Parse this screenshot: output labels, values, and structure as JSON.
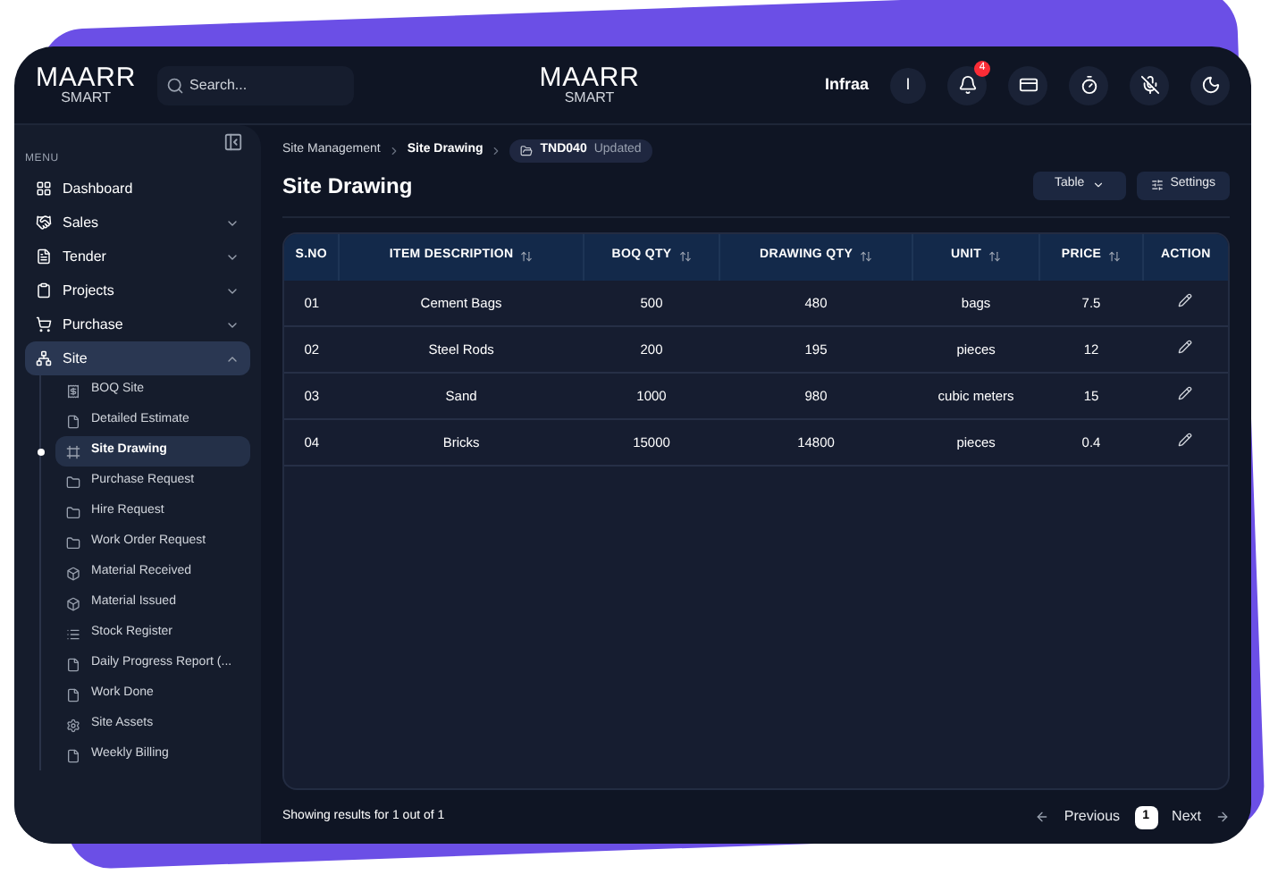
{
  "logo": {
    "name": "MAARR",
    "sub": "SMART"
  },
  "search": {
    "placeholder": "Search..."
  },
  "header": {
    "center_logo": {
      "name": "MAARR",
      "sub": "SMART"
    },
    "user": "Infraa",
    "avatar": "I",
    "notifications": "4"
  },
  "sidebar": {
    "menu_label": "MENU",
    "items": [
      {
        "label": "Dashboard",
        "expandable": false,
        "expanded": false,
        "selected": false
      },
      {
        "label": "Sales",
        "expandable": true,
        "expanded": false,
        "selected": false
      },
      {
        "label": "Tender",
        "expandable": true,
        "expanded": false,
        "selected": false
      },
      {
        "label": "Projects",
        "expandable": true,
        "expanded": false,
        "selected": false
      },
      {
        "label": "Purchase",
        "expandable": true,
        "expanded": false,
        "selected": false
      },
      {
        "label": "Site",
        "expandable": true,
        "expanded": true,
        "selected": true,
        "children": [
          {
            "label": "BOQ Site",
            "selected": false
          },
          {
            "label": "Detailed Estimate",
            "selected": false
          },
          {
            "label": "Site Drawing",
            "selected": true
          },
          {
            "label": "Purchase Request",
            "selected": false
          },
          {
            "label": "Hire Request",
            "selected": false
          },
          {
            "label": "Work Order Request",
            "selected": false
          },
          {
            "label": "Material Received",
            "selected": false
          },
          {
            "label": "Material Issued",
            "selected": false
          },
          {
            "label": "Stock Register",
            "selected": false
          },
          {
            "label": "Daily Progress Report (...",
            "selected": false
          },
          {
            "label": "Work Done",
            "selected": false
          },
          {
            "label": "Site Assets",
            "selected": false
          },
          {
            "label": "Weekly Billing",
            "selected": false
          }
        ]
      }
    ]
  },
  "breadcrumb": [
    "Site Management",
    "Site Drawing"
  ],
  "tag": {
    "code": "TND040",
    "status": "Updated"
  },
  "page_title": "Site Drawing",
  "toolbar": {
    "view": "Table",
    "settings": "Settings"
  },
  "table": {
    "columns": [
      {
        "label": "S.NO",
        "sortable": false
      },
      {
        "label": "ITEM DESCRIPTION",
        "sortable": true
      },
      {
        "label": "BOQ QTY",
        "sortable": true
      },
      {
        "label": "DRAWING QTY",
        "sortable": true
      },
      {
        "label": "UNIT",
        "sortable": true
      },
      {
        "label": "PRICE",
        "sortable": true
      },
      {
        "label": "ACTION",
        "sortable": false
      }
    ],
    "rows": [
      [
        "01",
        "Cement Bags",
        "500",
        "480",
        "bags",
        "7.5"
      ],
      [
        "02",
        "Steel Rods",
        "200",
        "195",
        "pieces",
        "12"
      ],
      [
        "03",
        "Sand",
        "1000",
        "980",
        "cubic meters",
        "15"
      ],
      [
        "04",
        "Bricks",
        "15000",
        "14800",
        "pieces",
        "0.4"
      ]
    ]
  },
  "footer": {
    "summary": "Showing results for 1 out of 1",
    "previous": "Previous",
    "page": "1",
    "next": "Next"
  }
}
